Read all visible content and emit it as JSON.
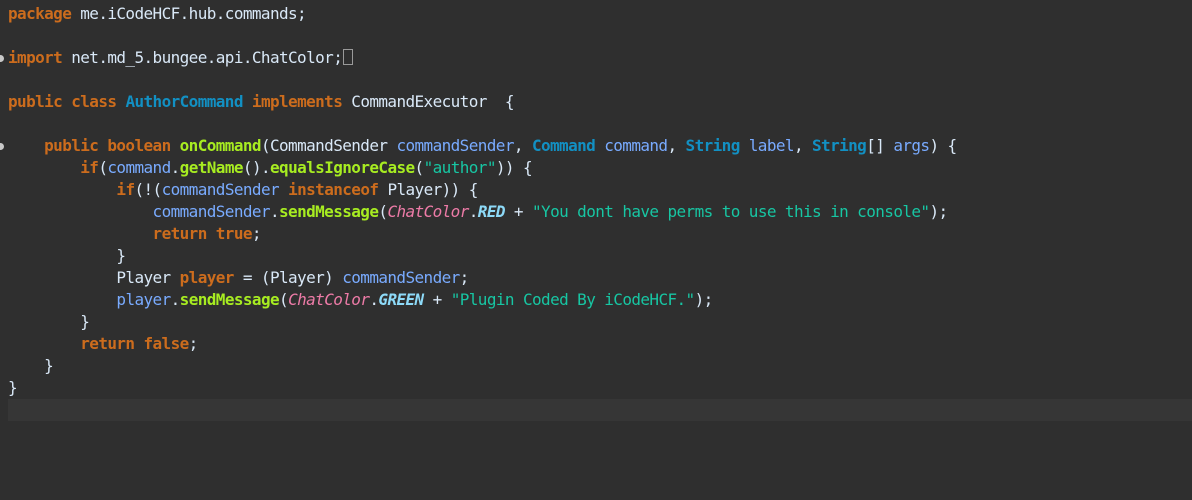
{
  "colors": {
    "background": "#2f2f2f",
    "current_line": "#363636",
    "keyword": "#cc6c1d",
    "type": "#1290c3",
    "method": "#a7ec21",
    "field": "#8ddaf8",
    "string": "#17c6a3",
    "static_class": "#ed7ba7",
    "variable": "#79abff",
    "plain": "#d9e8f7"
  },
  "editor": {
    "lines": [
      [
        {
          "t": "package",
          "c": "keyword"
        },
        {
          "t": " me.iCodeHCF.hub.commands;",
          "c": "plain"
        }
      ],
      [],
      [
        {
          "t": "import",
          "c": "keyword"
        },
        {
          "t": " net.md_5.bungee.api.ChatColor;",
          "c": "plain"
        },
        {
          "t": "",
          "c": "box"
        }
      ],
      [],
      [
        {
          "t": "public class ",
          "c": "keyword"
        },
        {
          "t": "AuthorCommand",
          "c": "type"
        },
        {
          "t": " implements ",
          "c": "keyword"
        },
        {
          "t": "CommandExecutor",
          "c": "plain"
        },
        {
          "t": "  {",
          "c": "plain"
        }
      ],
      [],
      [
        {
          "t": "    ",
          "c": "plain"
        },
        {
          "t": "public boolean ",
          "c": "keyword"
        },
        {
          "t": "onCommand",
          "c": "method"
        },
        {
          "t": "(CommandSender ",
          "c": "plain"
        },
        {
          "t": "commandSender",
          "c": "variable"
        },
        {
          "t": ", ",
          "c": "plain"
        },
        {
          "t": "Command",
          "c": "type"
        },
        {
          "t": " command",
          "c": "variable"
        },
        {
          "t": ", ",
          "c": "plain"
        },
        {
          "t": "String",
          "c": "type"
        },
        {
          "t": " label",
          "c": "variable"
        },
        {
          "t": ", ",
          "c": "plain"
        },
        {
          "t": "String",
          "c": "type"
        },
        {
          "t": "[] ",
          "c": "plain"
        },
        {
          "t": "args",
          "c": "variable"
        },
        {
          "t": ") {",
          "c": "plain"
        }
      ],
      [
        {
          "t": "        ",
          "c": "plain"
        },
        {
          "t": "if",
          "c": "keyword"
        },
        {
          "t": "(",
          "c": "plain"
        },
        {
          "t": "command",
          "c": "variable"
        },
        {
          "t": ".",
          "c": "plain"
        },
        {
          "t": "getName",
          "c": "method"
        },
        {
          "t": "().",
          "c": "plain"
        },
        {
          "t": "equalsIgnoreCase",
          "c": "method"
        },
        {
          "t": "(",
          "c": "plain"
        },
        {
          "t": "\"author\"",
          "c": "string"
        },
        {
          "t": ")) {",
          "c": "plain"
        }
      ],
      [
        {
          "t": "            ",
          "c": "plain"
        },
        {
          "t": "if",
          "c": "keyword"
        },
        {
          "t": "(!(",
          "c": "plain"
        },
        {
          "t": "commandSender",
          "c": "variable"
        },
        {
          "t": " instanceof ",
          "c": "keyword"
        },
        {
          "t": "Player)) {",
          "c": "plain"
        }
      ],
      [
        {
          "t": "                ",
          "c": "plain"
        },
        {
          "t": "commandSender",
          "c": "variable"
        },
        {
          "t": ".",
          "c": "plain"
        },
        {
          "t": "sendMessage",
          "c": "method"
        },
        {
          "t": "(",
          "c": "plain"
        },
        {
          "t": "ChatColor",
          "c": "static_class"
        },
        {
          "t": ".",
          "c": "plain"
        },
        {
          "t": "RED",
          "c": "field"
        },
        {
          "t": " + ",
          "c": "plain"
        },
        {
          "t": "\"You dont have perms to use this in console\"",
          "c": "string"
        },
        {
          "t": ");",
          "c": "plain"
        }
      ],
      [
        {
          "t": "                ",
          "c": "plain"
        },
        {
          "t": "return true",
          "c": "keyword"
        },
        {
          "t": ";",
          "c": "plain"
        }
      ],
      [
        {
          "t": "            }",
          "c": "plain"
        }
      ],
      [
        {
          "t": "            Player ",
          "c": "plain"
        },
        {
          "t": "player",
          "c": "keyword"
        },
        {
          "t": " = (Player) ",
          "c": "plain"
        },
        {
          "t": "commandSender",
          "c": "variable"
        },
        {
          "t": ";",
          "c": "plain"
        }
      ],
      [
        {
          "t": "            ",
          "c": "plain"
        },
        {
          "t": "player",
          "c": "variable"
        },
        {
          "t": ".",
          "c": "plain"
        },
        {
          "t": "sendMessage",
          "c": "method"
        },
        {
          "t": "(",
          "c": "plain"
        },
        {
          "t": "ChatColor",
          "c": "static_class"
        },
        {
          "t": ".",
          "c": "plain"
        },
        {
          "t": "GREEN",
          "c": "field"
        },
        {
          "t": " + ",
          "c": "plain"
        },
        {
          "t": "\"Plugin Coded By iCodeHCF.\"",
          "c": "string"
        },
        {
          "t": ");",
          "c": "plain"
        }
      ],
      [
        {
          "t": "        }",
          "c": "plain"
        }
      ],
      [
        {
          "t": "        ",
          "c": "plain"
        },
        {
          "t": "return false",
          "c": "keyword"
        },
        {
          "t": ";",
          "c": "plain"
        }
      ],
      [
        {
          "t": "    }",
          "c": "plain"
        }
      ],
      [
        {
          "t": "}",
          "c": "plain"
        }
      ],
      []
    ],
    "fold_markers": [
      2,
      6
    ],
    "current_line": 18
  }
}
